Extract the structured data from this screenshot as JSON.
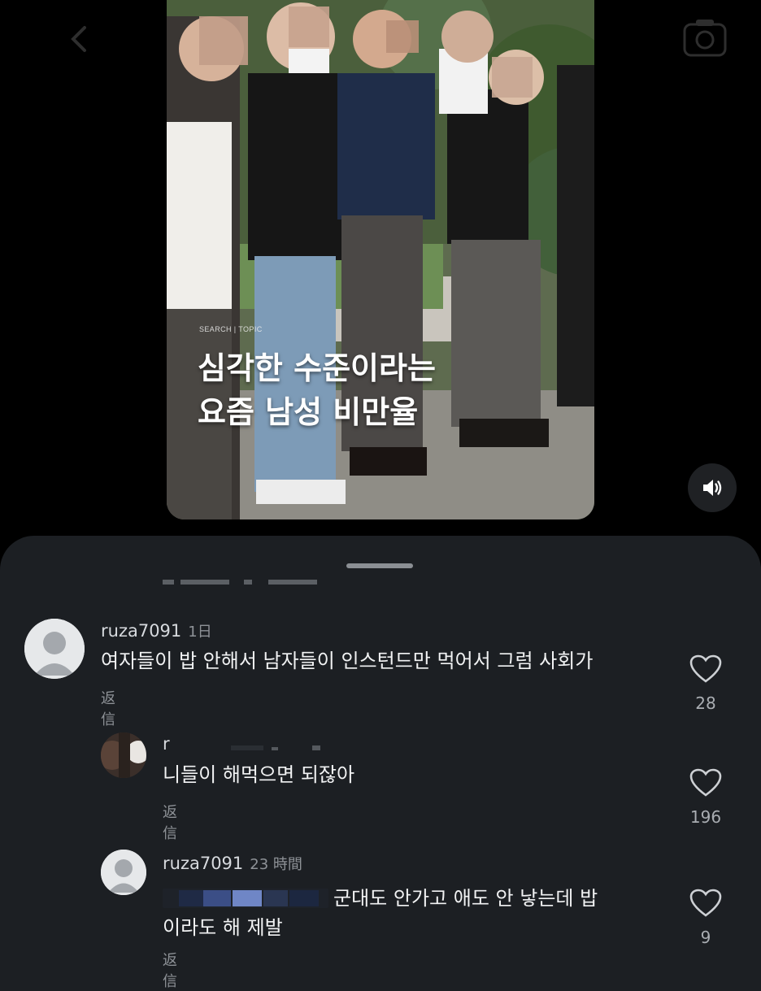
{
  "video": {
    "overlay_label": "SEARCH | TOPIC",
    "title_line1": "심각한 수준이라는",
    "title_line2": "요즘 남성 비만율"
  },
  "icons": {
    "back": "chevron-left-icon",
    "camera": "camera-icon",
    "volume": "speaker-icon",
    "like": "heart-icon"
  },
  "comments": [
    {
      "username": "ruza7091",
      "time": "1日",
      "text": "여자들이 밥 안해서 남자들이 인스턴드만 먹어서 그럼 사회가",
      "reply_label": "返信",
      "likes": "28"
    },
    {
      "username": "r",
      "time": "",
      "text": "니들이 해먹으면 되잖아",
      "reply_label": "返信",
      "likes": "196"
    },
    {
      "username": "ruza7091",
      "time": "23 時間",
      "text_line1": "군대도 안가고 애도 안 낳는데 밥",
      "text_line2": "이라도 해 제발",
      "reply_label": "返信",
      "likes": "9"
    }
  ],
  "colors": {
    "sheet_bg": "#1c1f23",
    "muted_text": "#8e9297",
    "primary_text": "#f1f2f3"
  }
}
